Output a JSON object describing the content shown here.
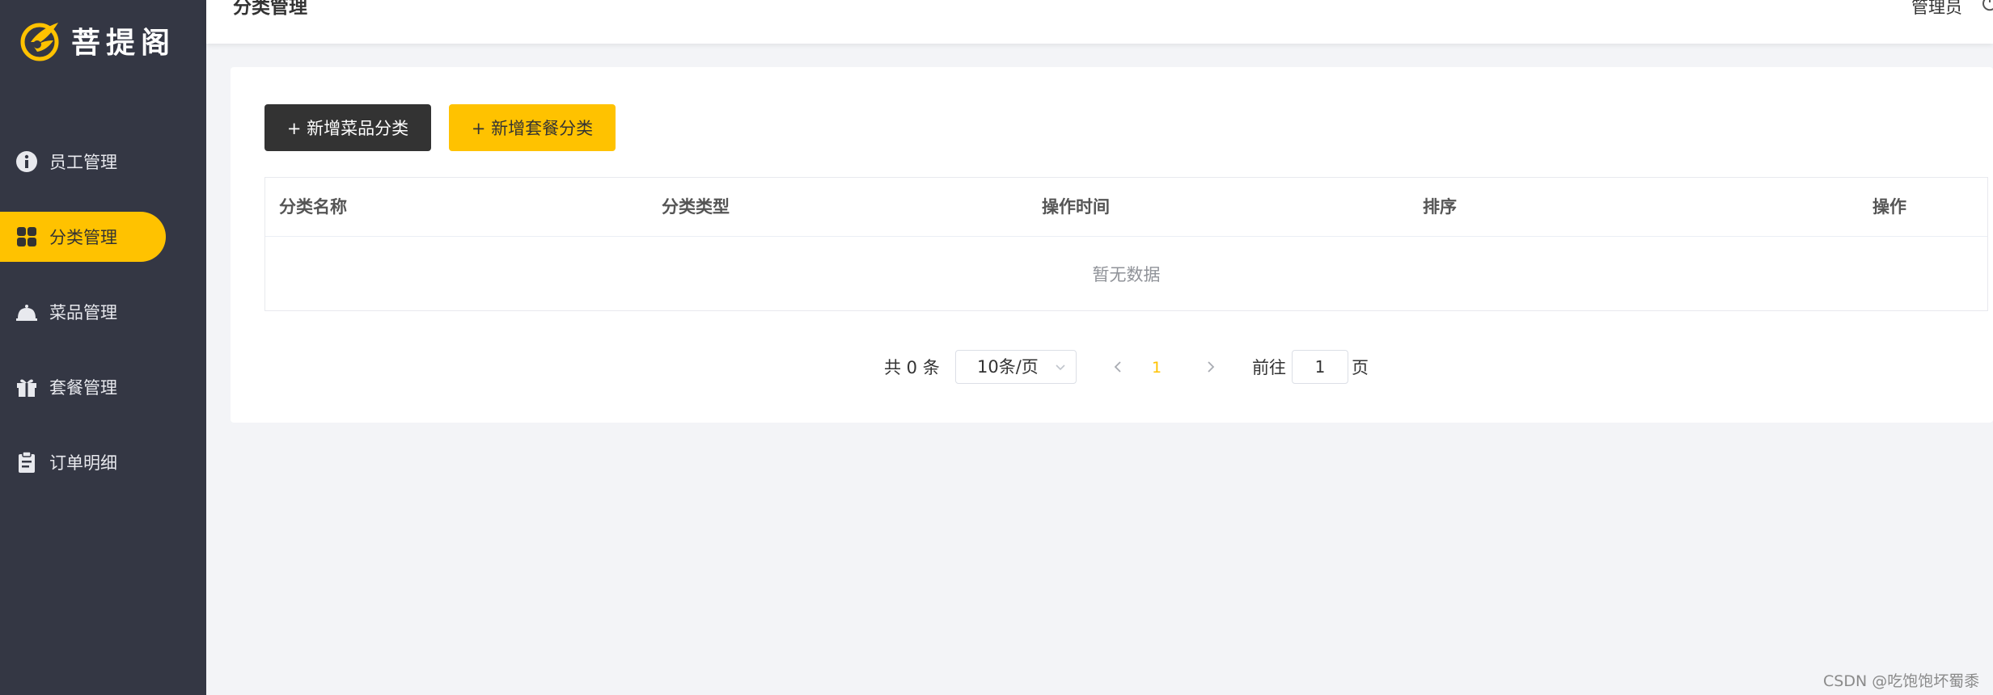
{
  "app": {
    "logo_text": "菩提阁"
  },
  "sidebar": {
    "items": [
      {
        "label": "员工管理",
        "icon": "employee-icon"
      },
      {
        "label": "分类管理",
        "icon": "category-grid-icon"
      },
      {
        "label": "菜品管理",
        "icon": "dish-cloche-icon"
      },
      {
        "label": "套餐管理",
        "icon": "gift-box-icon"
      },
      {
        "label": "订单明细",
        "icon": "clipboard-icon"
      }
    ],
    "active_index": 1
  },
  "header": {
    "title": "分类管理",
    "user": "管理员",
    "logout_icon": "power-icon"
  },
  "toolbar": {
    "add_dish_category": "+ 新增菜品分类",
    "add_setmeal_category": "+ 新增套餐分类"
  },
  "table": {
    "columns": [
      "分类名称",
      "分类类型",
      "操作时间",
      "排序",
      "操作"
    ],
    "empty_text": "暂无数据"
  },
  "pagination": {
    "total_text": "共 0 条",
    "page_size": "10条/页",
    "current_page": "1",
    "goto_label": "前往",
    "goto_value": "1",
    "goto_suffix": "页"
  },
  "watermark": "CSDN @吃饱饱坏蜀黍",
  "colors": {
    "sidebar_bg": "#343744",
    "accent": "#ffc200",
    "dark_button": "#333333",
    "page_bg": "#f3f4f7"
  }
}
